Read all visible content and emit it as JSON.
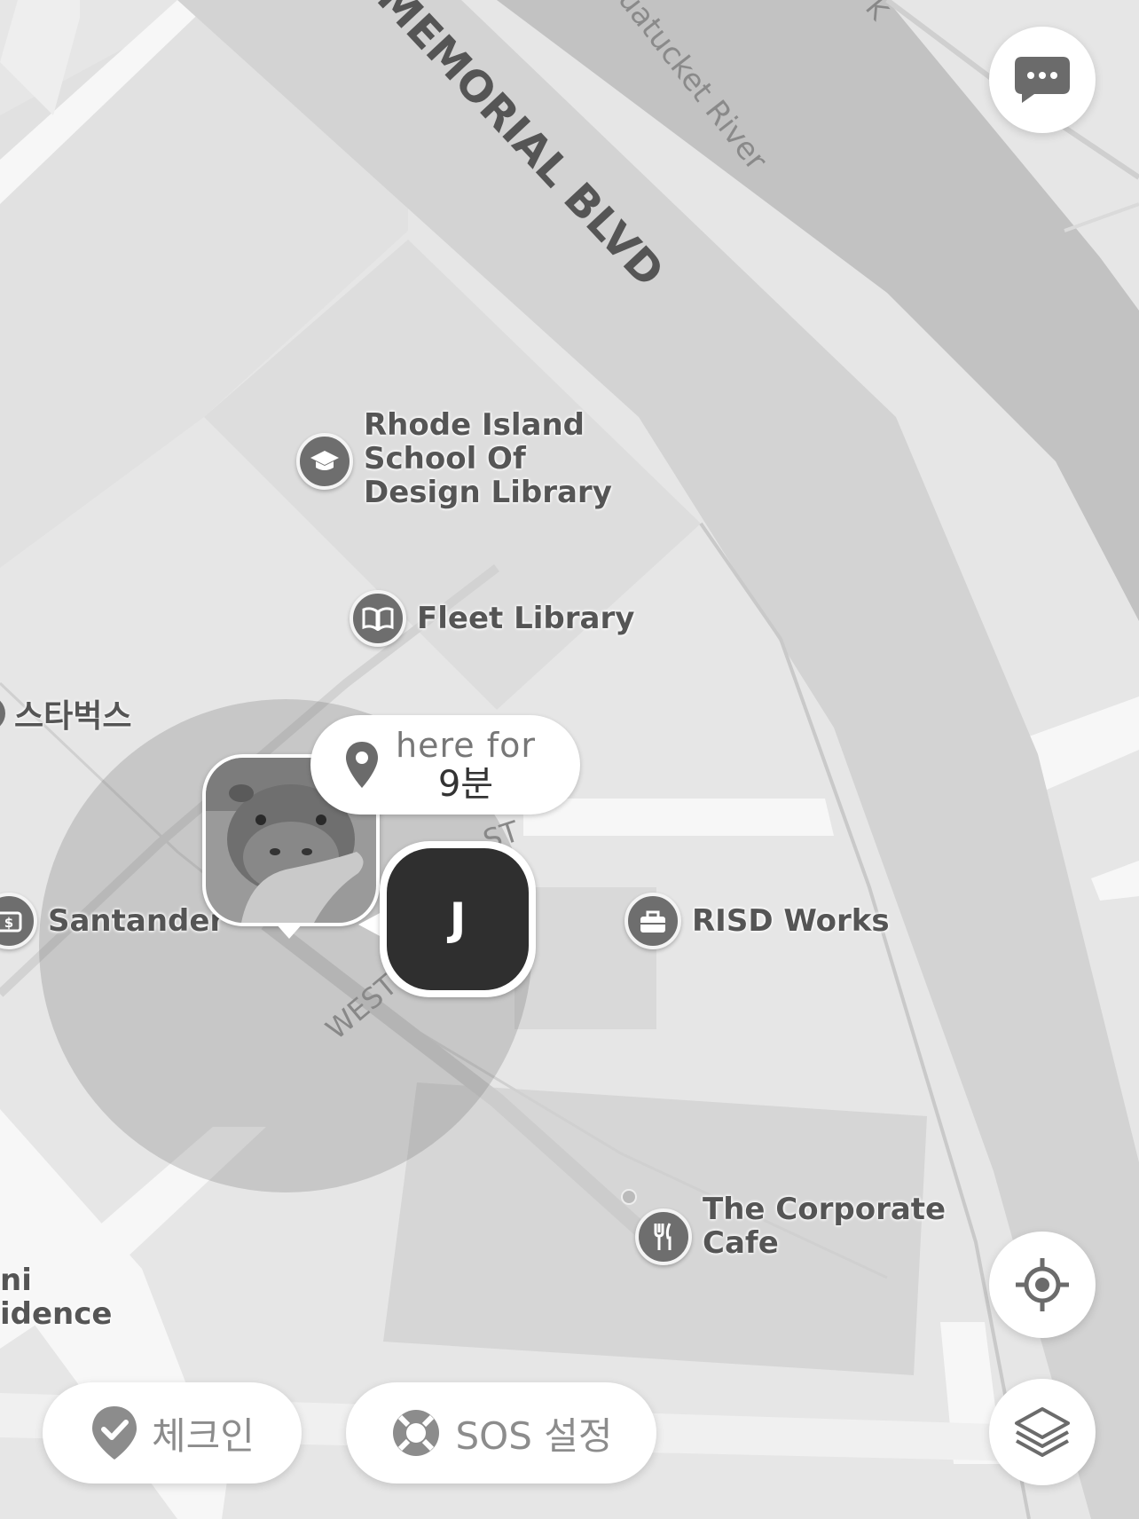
{
  "map": {
    "roads": {
      "memorial_blvd": "MEMORIAL BLVD",
      "west_st": "WEST",
      "st_fragment": "ST",
      "top_right_fragment": "K"
    },
    "river": "uatucket River",
    "pois": {
      "risd_library": {
        "label": "Rhode Island\nSchool Of\nDesign Library",
        "icon": "graduation-cap-icon"
      },
      "fleet_library": {
        "label": "Fleet Library",
        "icon": "open-book-icon"
      },
      "santander": {
        "label": "Santander",
        "icon": "bank-icon"
      },
      "risd_works": {
        "label": "RISD Works",
        "icon": "shopping-bag-icon"
      },
      "corporate_cafe": {
        "label": "The Corporate\nCafe",
        "icon": "fork-knife-icon"
      },
      "starbucks": {
        "label": "스타벅스"
      },
      "residence_fragment": {
        "label": "ni\nidence"
      }
    }
  },
  "status_bubble": {
    "line1": "here for",
    "line2": "9분",
    "icon": "location-pin-icon"
  },
  "user_marker": {
    "initial": "J"
  },
  "buttons": {
    "chat": {
      "icon": "chat-bubble-icon"
    },
    "locate": {
      "icon": "crosshair-icon"
    },
    "layers": {
      "icon": "layers-icon"
    },
    "checkin": {
      "label": "체크인",
      "icon": "checkin-pin-icon"
    },
    "sos": {
      "label": "SOS 설정",
      "icon": "lifebuoy-icon"
    }
  }
}
